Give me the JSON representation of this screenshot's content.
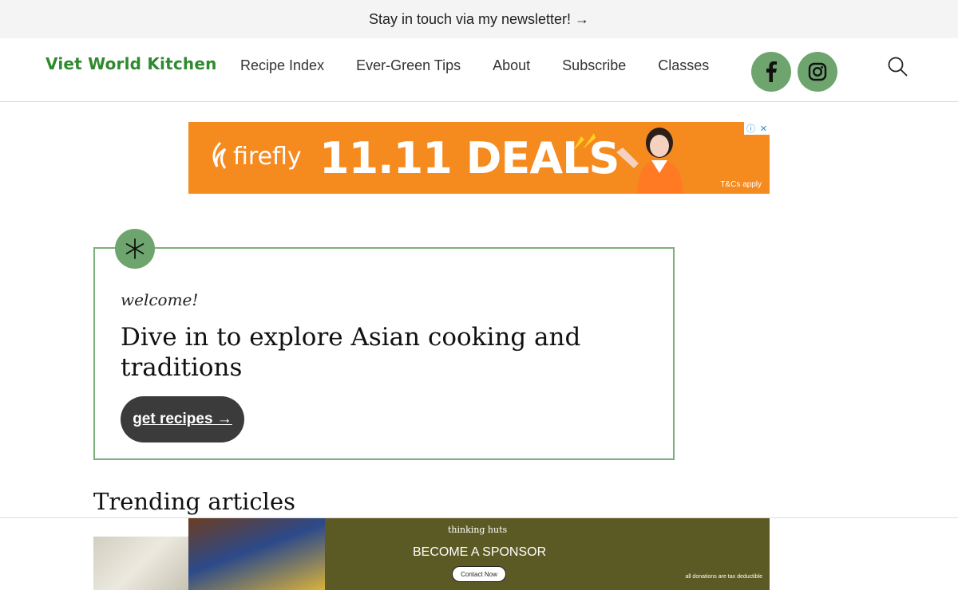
{
  "topbar": {
    "text": "Stay in touch via my newsletter! →"
  },
  "header": {
    "logo": "Viet World Kitchen",
    "nav": [
      "Recipe Index",
      "Ever-Green Tips",
      "About",
      "Subscribe",
      "Classes"
    ],
    "social": [
      {
        "name": "facebook",
        "icon": "facebook-icon"
      },
      {
        "name": "instagram",
        "icon": "instagram-icon"
      }
    ],
    "search_icon": "search-icon"
  },
  "ad_top": {
    "brand": "firefly",
    "headline": "11.11 DEALS",
    "fine_print": "T&Cs apply"
  },
  "welcome": {
    "icon": "asterisk-icon",
    "kicker": "welcome!",
    "title": "Dive in to explore Asian cooking and traditions",
    "cta": "get recipes →"
  },
  "trending": {
    "heading": "Trending articles"
  },
  "ad_bottom": {
    "brand": "thinking huts",
    "headline": "BECOME A SPONSOR",
    "button": "Contact Now",
    "fine_print": "all donations are tax deductible"
  },
  "colors": {
    "brand_green": "#2f8a2f",
    "accent_green": "#6ea46e",
    "ad_orange": "#f58a1f",
    "ad_olive": "#5c5a24"
  }
}
